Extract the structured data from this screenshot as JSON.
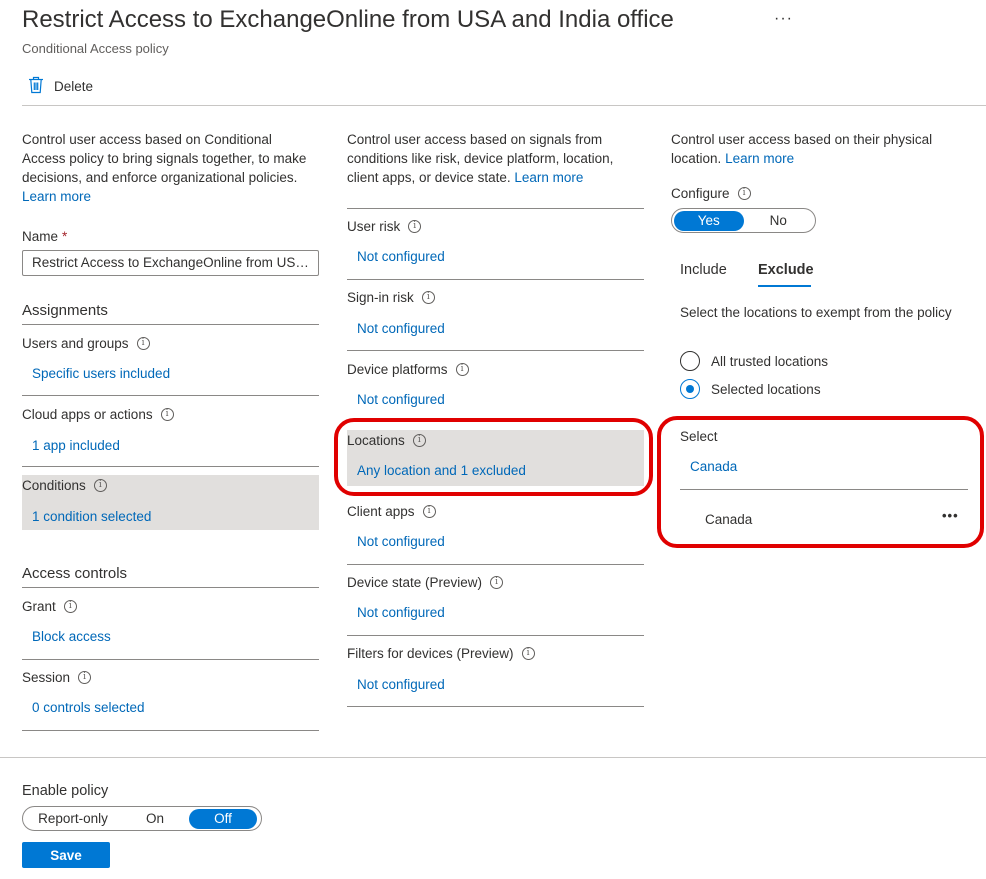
{
  "header": {
    "title": "Restrict Access to ExchangeOnline from USA and India office",
    "more": "···",
    "subtitle": "Conditional Access policy",
    "delete_label": "Delete"
  },
  "left": {
    "intro_text": "Control user access based on Conditional Access policy to bring signals together, to make decisions, and enforce organizational policies.",
    "learn_more": "Learn more",
    "name_label": "Name",
    "name_required": "*",
    "name_value": "Restrict Access to ExchangeOnline from USA and India office",
    "assignments_header": "Assignments",
    "users_label": "Users and groups",
    "users_value": "Specific users included",
    "cloud_label": "Cloud apps or actions",
    "cloud_value": "1 app included",
    "conditions_label": "Conditions",
    "conditions_value": "1 condition selected",
    "access_header": "Access controls",
    "grant_label": "Grant",
    "grant_value": "Block access",
    "session_label": "Session",
    "session_value": "0 controls selected"
  },
  "middle": {
    "intro_text": "Control user access based on signals from conditions like risk, device platform, location, client apps, or device state.",
    "learn_more": "Learn more",
    "items": [
      {
        "label": "User risk",
        "value": "Not configured"
      },
      {
        "label": "Sign-in risk",
        "value": "Not configured"
      },
      {
        "label": "Device platforms",
        "value": "Not configured"
      },
      {
        "label": "Locations",
        "value": "Any location and 1 excluded"
      },
      {
        "label": "Client apps",
        "value": "Not configured"
      },
      {
        "label": "Device state (Preview)",
        "value": "Not configured"
      },
      {
        "label": "Filters for devices (Preview)",
        "value": "Not configured"
      }
    ]
  },
  "right": {
    "intro_text": "Control user access based on their physical location.",
    "learn_more": "Learn more",
    "configure_label": "Configure",
    "toggle_yes": "Yes",
    "toggle_no": "No",
    "toggle_selected": "Yes",
    "tab_include": "Include",
    "tab_exclude": "Exclude",
    "active_tab": "Exclude",
    "exempt_text": "Select the locations to exempt from the policy",
    "radio_all": "All trusted locations",
    "radio_selected": "Selected locations",
    "radio_checked": "Selected locations",
    "select_label": "Select",
    "select_value": "Canada",
    "list_item": "Canada",
    "list_item_more": "•••"
  },
  "footer": {
    "enable_label": "Enable policy",
    "opt_report": "Report-only",
    "opt_on": "On",
    "opt_off": "Off",
    "selected": "Off",
    "save_label": "Save"
  },
  "colors": {
    "accent": "#0078d4",
    "link": "#0068b8",
    "highlight": "#e1dfdd",
    "annotation_red": "#e00000"
  }
}
